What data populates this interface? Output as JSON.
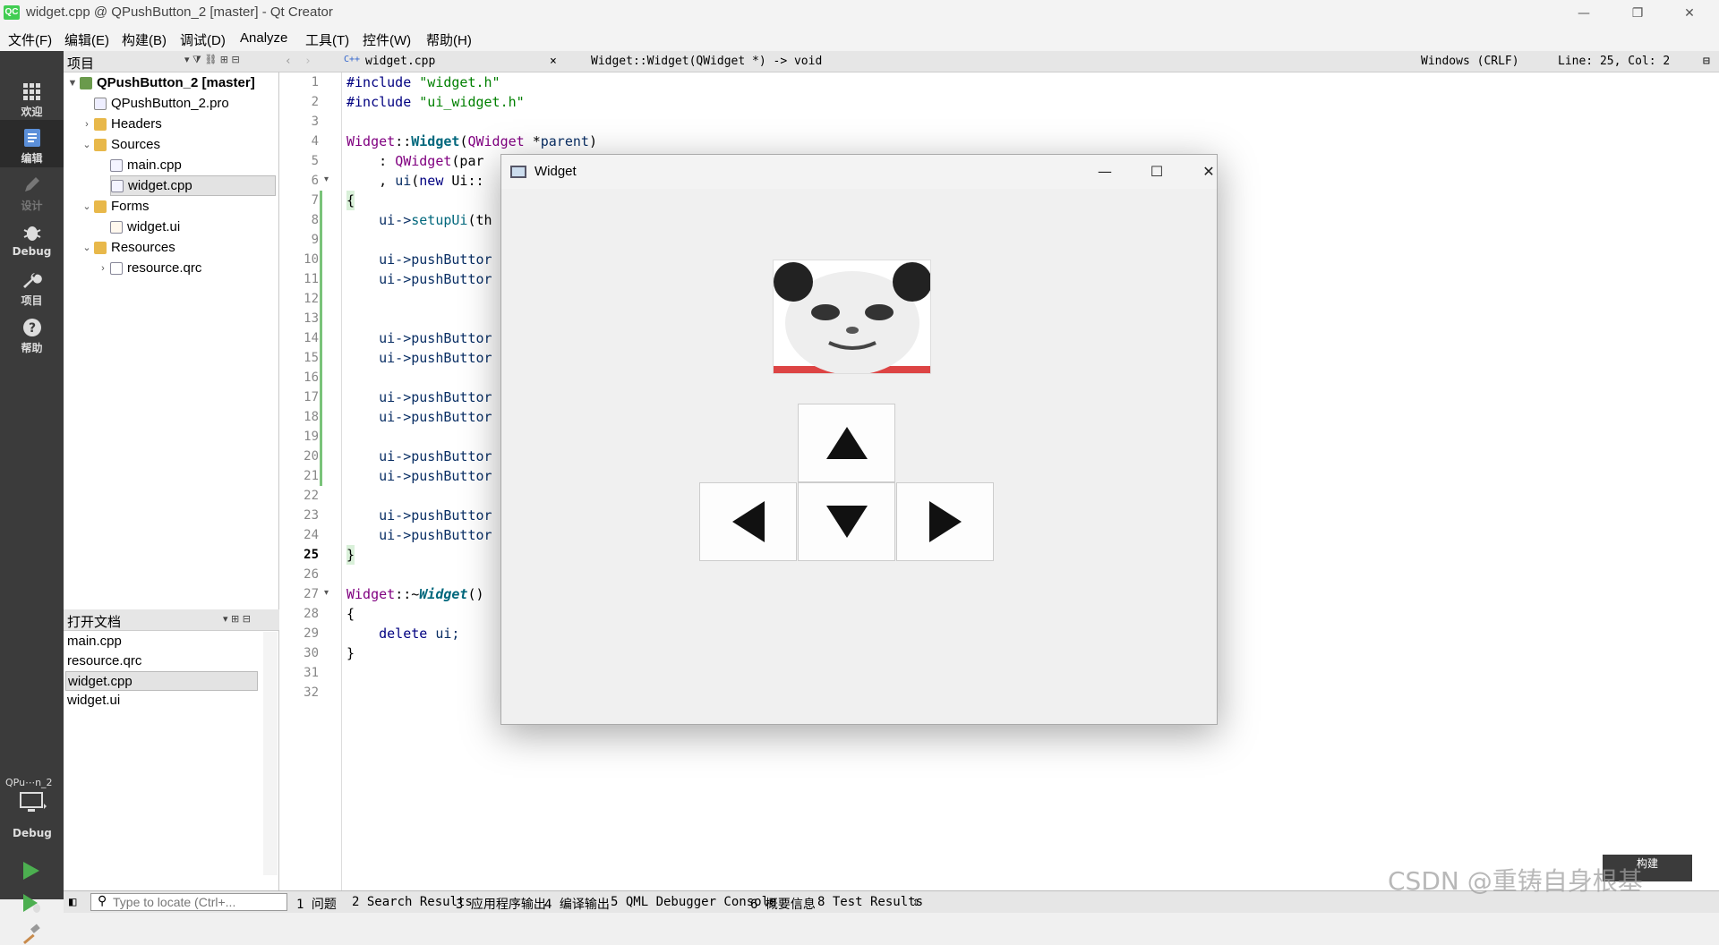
{
  "window": {
    "title": "widget.cpp @ QPushButton_2 [master] - Qt Creator",
    "app_icon_text": "QC"
  },
  "menu": [
    "文件(F)",
    "编辑(E)",
    "构建(B)",
    "调试(D)",
    "Analyze",
    "工具(T)",
    "控件(W)",
    "帮助(H)"
  ],
  "modes": {
    "welcome": "欢迎",
    "edit": "编辑",
    "design": "设计",
    "debug": "Debug",
    "projects": "项目",
    "help": "帮助"
  },
  "kit": {
    "name": "QPu⋯n_2",
    "mode": "Debug"
  },
  "project_panel": {
    "title": "项目",
    "tree": {
      "root": "QPushButton_2 [master]",
      "pro": "QPushButton_2.pro",
      "headers": "Headers",
      "sources": "Sources",
      "main_cpp": "main.cpp",
      "widget_cpp": "widget.cpp",
      "forms": "Forms",
      "widget_ui": "widget.ui",
      "resources": "Resources",
      "resource_qrc": "resource.qrc"
    }
  },
  "open_docs": {
    "title": "打开文档",
    "items": [
      "main.cpp",
      "resource.qrc",
      "widget.cpp",
      "widget.ui"
    ]
  },
  "editor_toolbar": {
    "file": "widget.cpp",
    "symbol": "Widget::Widget(QWidget *) -> void",
    "line_ending": "Windows (CRLF)",
    "position": "Line: 25, Col: 2"
  },
  "code": {
    "line_numbers": [
      "1",
      "2",
      "3",
      "4",
      "5",
      "6",
      "7",
      "8",
      "9",
      "10",
      "11",
      "12",
      "13",
      "14",
      "15",
      "16",
      "17",
      "18",
      "19",
      "20",
      "21",
      "22",
      "23",
      "24",
      "25",
      "26",
      "27",
      "28",
      "29",
      "30",
      "31",
      "32"
    ],
    "l1a": "#include",
    "l1b": " \"widget.h\"",
    "l2a": "#include",
    "l2b": " \"ui_widget.h\"",
    "l4a": "Widget",
    "l4b": "::",
    "l4c": "Widget",
    "l4d": "(",
    "l4e": "QWidget",
    "l4f": " *",
    "l4g": "parent",
    "l4h": ")",
    "l5a": "    : ",
    "l5b": "QWidget",
    "l5c": "(par",
    "l6a": "    , ",
    "l6b": "ui",
    "l6c": "(",
    "l6d": "new",
    "l6e": " Ui::",
    "l7": "{",
    "l8a": "    ui->",
    "l8b": "setupUi",
    "l8c": "(th",
    "push": "    ui->pushButtor",
    "l25": "}",
    "l27a": "Widget",
    "l27b": "::~",
    "l27c": "Widget",
    "l27d": "()",
    "l28": "{",
    "l29a": "    delete",
    "l29b": " ui;",
    "l30": "}"
  },
  "dialog": {
    "title": "Widget",
    "min": "—",
    "max": "☐",
    "close": "✕"
  },
  "status_bar": {
    "locate_placeholder": "Type to locate (Ctrl+...",
    "tabs": [
      "1 问题",
      "2 Search Results",
      "3 应用程序输出",
      "4 编译输出",
      "5 QML Debugger Console",
      "6 概要信息",
      "8 Test Results"
    ]
  },
  "build_button": "构建",
  "watermark": "CSDN @重铸自身根基"
}
